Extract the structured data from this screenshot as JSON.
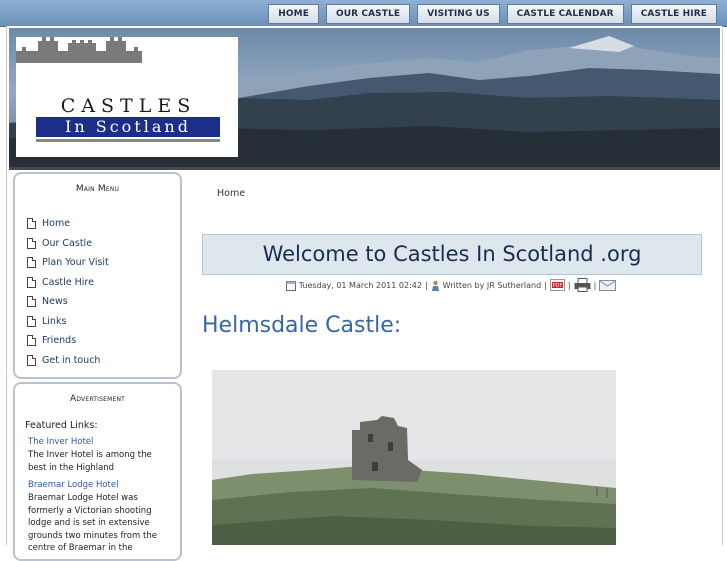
{
  "nav": [
    "HOME",
    "OUR CASTLE",
    "VISITING US",
    "CASTLE CALENDAR",
    "CASTLE HIRE"
  ],
  "logo": {
    "line1": "CASTLES",
    "line2": "In Scotland"
  },
  "main_menu": {
    "title": "Main Menu",
    "items": [
      "Home",
      "Our Castle",
      "Plan Your Visit",
      "Castle Hire",
      "News",
      "Links",
      "Friends",
      "Get in touch"
    ]
  },
  "advertisement": {
    "title": "Advertisement",
    "featured": "Featured Links:",
    "links": [
      {
        "title": "The Inver Hotel",
        "text": "The Inver Hotel is among the best in the Highland"
      },
      {
        "title": "Braemar Lodge Hotel",
        "text": "Braemar Lodge Hotel was formerly a Victorian shooting lodge and is set in extensive grounds two minutes from the centre of Braemar in the"
      }
    ]
  },
  "breadcrumb": "Home",
  "article": {
    "title": "Welcome to Castles In Scotland .org",
    "date": "Tuesday, 01 March 2011 02:42",
    "author": "Written by JR Sutherland",
    "heading": "Helmsdale Castle:"
  },
  "icons": [
    "calendar-icon",
    "author-icon",
    "pdf-icon",
    "print-icon",
    "email-icon"
  ],
  "colors": {
    "accent": "#3566a5",
    "nav_bar": "#7b9cc2",
    "title_bg": "#dfe7ee"
  }
}
